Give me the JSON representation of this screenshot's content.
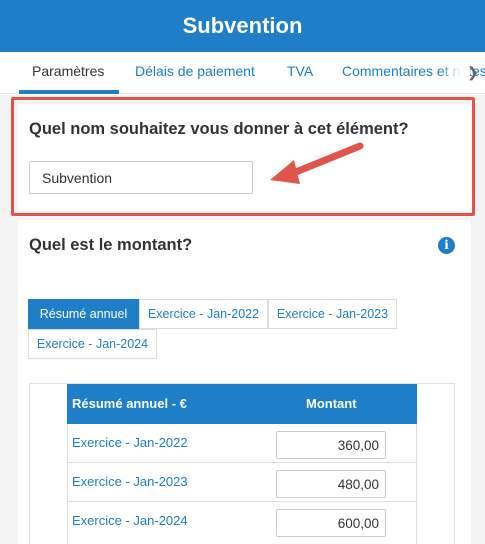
{
  "header": {
    "title": "Subvention"
  },
  "tabs": [
    {
      "label": "Paramètres",
      "active": true
    },
    {
      "label": "Délais de paiement",
      "active": false
    },
    {
      "label": "TVA",
      "active": false
    },
    {
      "label": "Commentaires et notes",
      "active": false
    }
  ],
  "name_section": {
    "question": "Quel nom souhaitez vous donner à cet élément?",
    "value": "Subvention"
  },
  "amount_section": {
    "question": "Quel est le montant?",
    "periods": [
      {
        "label": "Résumé annuel",
        "active": true
      },
      {
        "label": "Exercice - Jan-2022",
        "active": false
      },
      {
        "label": "Exercice - Jan-2023",
        "active": false
      },
      {
        "label": "Exercice - Jan-2024",
        "active": false
      }
    ],
    "table": {
      "headers": [
        "Résumé annuel - €",
        "Montant"
      ],
      "rows": [
        {
          "label": "Exercice - Jan-2022",
          "amount": "360,00"
        },
        {
          "label": "Exercice - Jan-2023",
          "amount": "480,00"
        },
        {
          "label": "Exercice - Jan-2024",
          "amount": "600,00"
        }
      ]
    }
  },
  "colors": {
    "brand": "#1e7ec8",
    "highlight": "#e0554a"
  },
  "icons": {
    "info": "info-icon",
    "tabs_next": "chevron-right-icon",
    "annotation": "arrow-icon"
  }
}
